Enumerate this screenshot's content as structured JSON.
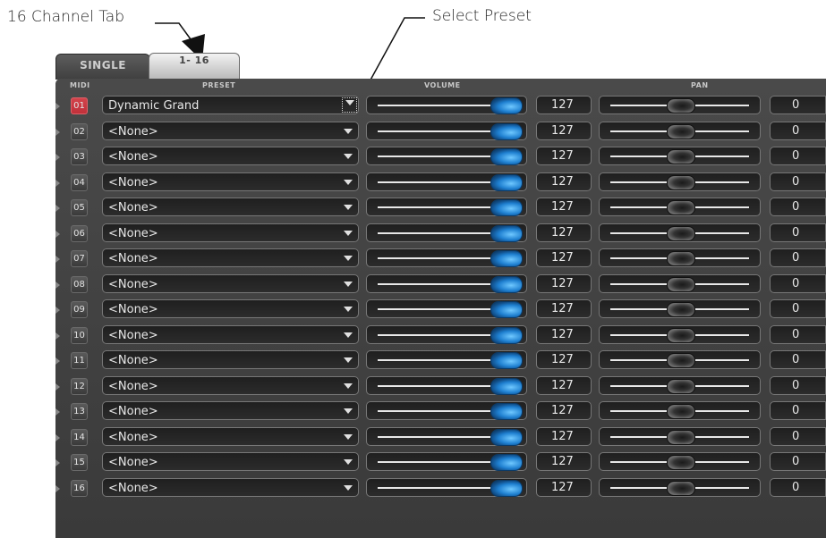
{
  "annotations": {
    "channel_tab": "16 Channel Tab",
    "select_preset": "Select Preset"
  },
  "tabs": [
    {
      "label": "SINGLE",
      "selected": false
    },
    {
      "label": "1- 16",
      "selected": true
    }
  ],
  "headers": {
    "midi": "MIDI",
    "preset": "PRESET",
    "volume": "VOLUME",
    "pan": "PAN"
  },
  "colors": {
    "active_midi": "#c0303a",
    "volume_thumb": "#1e7fd0"
  },
  "volume_max": 127,
  "pan_min": -64,
  "pan_max": 63,
  "channels": [
    {
      "midi": "01",
      "preset": "Dynamic Grand",
      "volume": "127",
      "pan": "0",
      "active": true
    },
    {
      "midi": "02",
      "preset": "<None>",
      "volume": "127",
      "pan": "0",
      "active": false
    },
    {
      "midi": "03",
      "preset": "<None>",
      "volume": "127",
      "pan": "0",
      "active": false
    },
    {
      "midi": "04",
      "preset": "<None>",
      "volume": "127",
      "pan": "0",
      "active": false
    },
    {
      "midi": "05",
      "preset": "<None>",
      "volume": "127",
      "pan": "0",
      "active": false
    },
    {
      "midi": "06",
      "preset": "<None>",
      "volume": "127",
      "pan": "0",
      "active": false
    },
    {
      "midi": "07",
      "preset": "<None>",
      "volume": "127",
      "pan": "0",
      "active": false
    },
    {
      "midi": "08",
      "preset": "<None>",
      "volume": "127",
      "pan": "0",
      "active": false
    },
    {
      "midi": "09",
      "preset": "<None>",
      "volume": "127",
      "pan": "0",
      "active": false
    },
    {
      "midi": "10",
      "preset": "<None>",
      "volume": "127",
      "pan": "0",
      "active": false
    },
    {
      "midi": "11",
      "preset": "<None>",
      "volume": "127",
      "pan": "0",
      "active": false
    },
    {
      "midi": "12",
      "preset": "<None>",
      "volume": "127",
      "pan": "0",
      "active": false
    },
    {
      "midi": "13",
      "preset": "<None>",
      "volume": "127",
      "pan": "0",
      "active": false
    },
    {
      "midi": "14",
      "preset": "<None>",
      "volume": "127",
      "pan": "0",
      "active": false
    },
    {
      "midi": "15",
      "preset": "<None>",
      "volume": "127",
      "pan": "0",
      "active": false
    },
    {
      "midi": "16",
      "preset": "<None>",
      "volume": "127",
      "pan": "0",
      "active": false
    }
  ]
}
